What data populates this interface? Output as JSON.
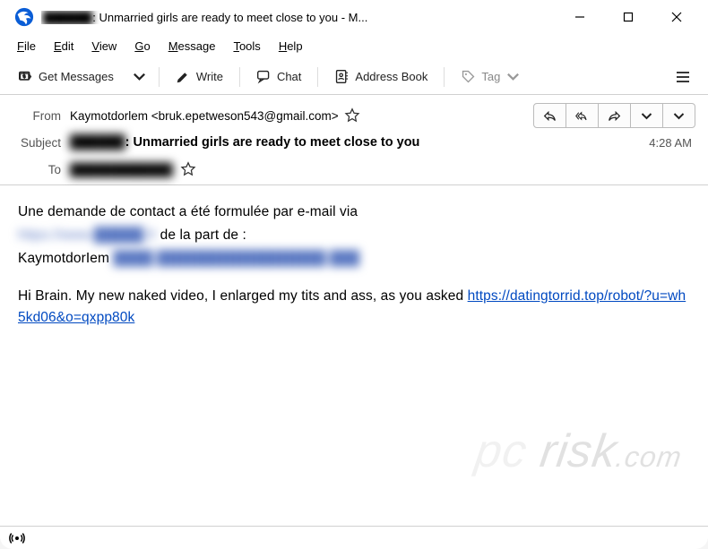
{
  "title": {
    "prefix_blur": "██████",
    "text": ": Unmarried girls are ready to meet close to you - M..."
  },
  "menu": {
    "file": "File",
    "edit": "Edit",
    "view": "View",
    "go": "Go",
    "message": "Message",
    "tools": "Tools",
    "help": "Help"
  },
  "toolbar": {
    "get_messages": "Get Messages",
    "write": "Write",
    "chat": "Chat",
    "address_book": "Address Book",
    "tag": "Tag"
  },
  "headers": {
    "from_label": "From",
    "from": "Kaymotdorlem <bruk.epetweson543@gmail.com>",
    "subject_label": "Subject",
    "subject_blur": "██████",
    "subject": ": Unmarried girls are ready to meet close to you",
    "time": "4:28 AM",
    "to_label": "To",
    "to_blur": "████████████"
  },
  "body": {
    "line1": "Une demande de contact a été formulée par e-mail via",
    "line2_blur": "https://www.█████.fr",
    "line2_rest": " de la part de :",
    "line3_name": "KaymotdorIem ",
    "line3_blur": "████.█████████████████.███",
    "line4": "Hi Brain. My new naked video, I enlarged my tits and ass, as you asked ",
    "link": "https://datingtorrid.top/robot/?u=wh5kd06&o=qxpp80k"
  },
  "watermark": "pc risk.com"
}
